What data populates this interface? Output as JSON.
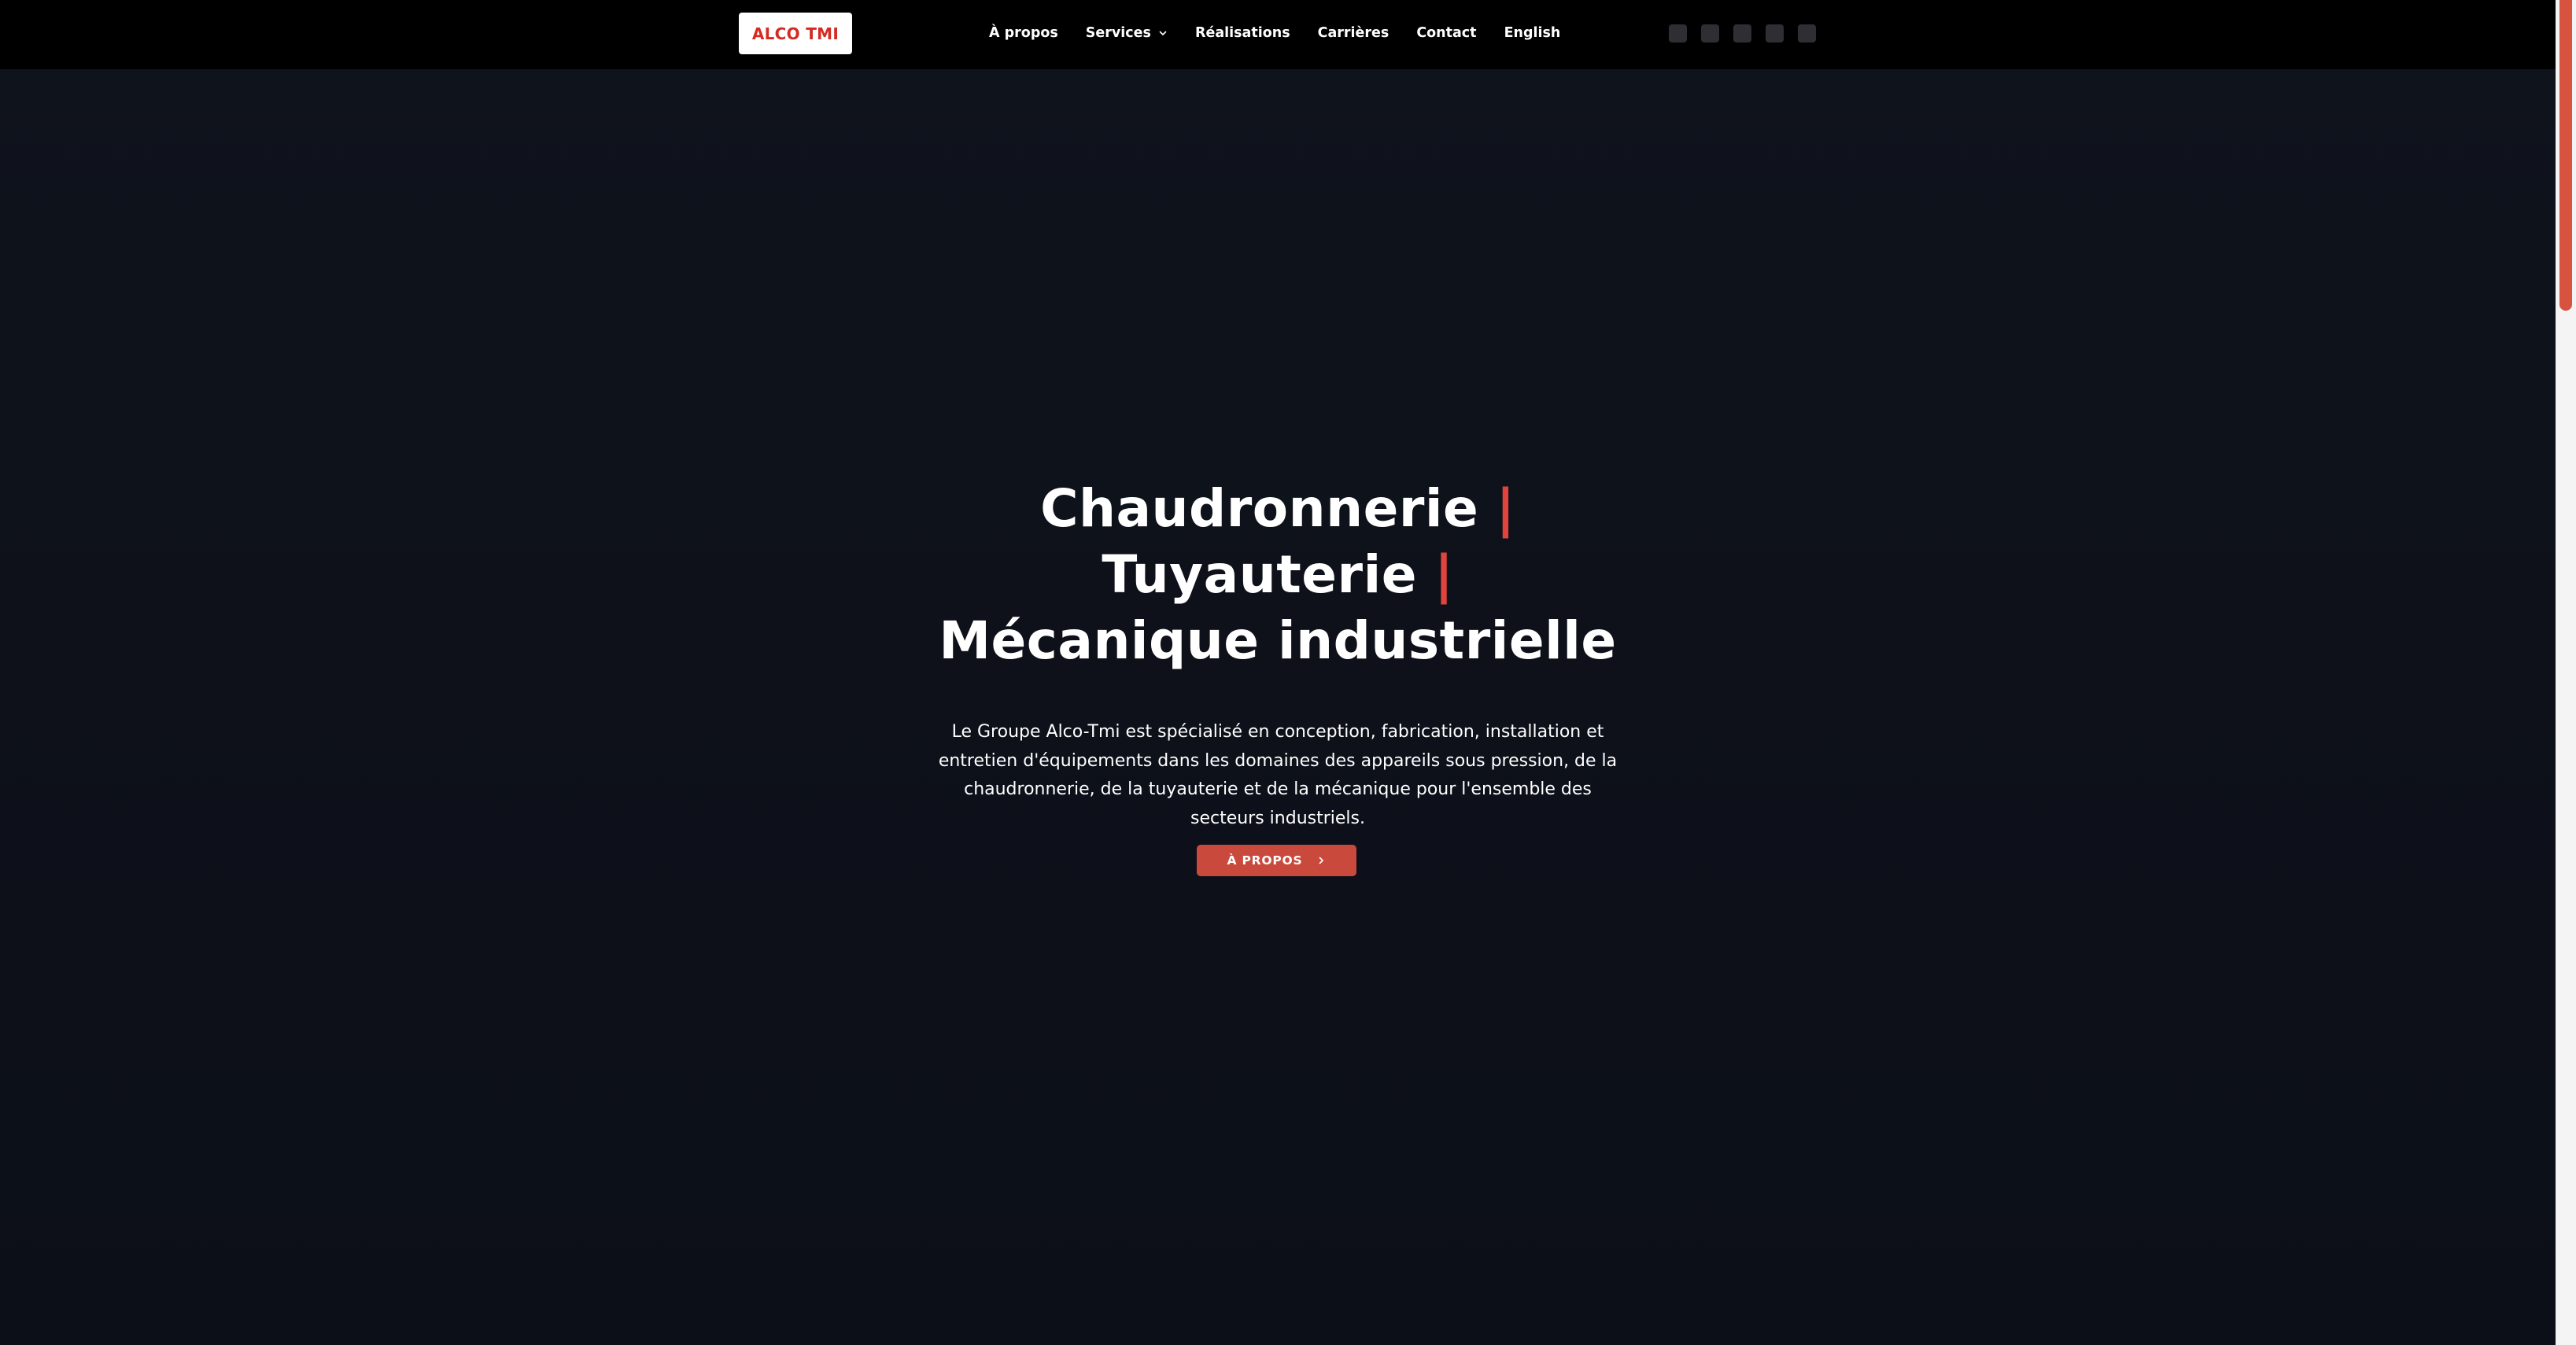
{
  "header": {
    "logo_text": "ALCO TMI",
    "nav": [
      {
        "label": "À propos"
      },
      {
        "label": "Services",
        "has_dropdown": true
      },
      {
        "label": "Réalisations"
      },
      {
        "label": "Carrières"
      },
      {
        "label": "Contact"
      },
      {
        "label": "English"
      }
    ],
    "social_icons": [
      "facebook-icon",
      "instagram-icon",
      "linkedin-icon",
      "youtube-icon",
      "twitter-icon"
    ]
  },
  "hero": {
    "lines": [
      "Chaudronnerie",
      "Tuyauterie",
      "Mécanique industrielle"
    ],
    "separator": "|",
    "description": "Le Groupe Alco-Tmi est spécialisé en conception, fabrication, installation et entretien d'équipements dans les domaines des appareils sous pression, de la chaudronnerie, de la tuyauterie et de la mécanique pour l'ensemble des secteurs industriels.",
    "cta_label": "À PROPOS"
  },
  "colors": {
    "accent": "#e0443d",
    "button": "#c94a3d",
    "logo_text": "#d42a22",
    "header_bg": "#000000",
    "page_bg": "#0d1019"
  }
}
